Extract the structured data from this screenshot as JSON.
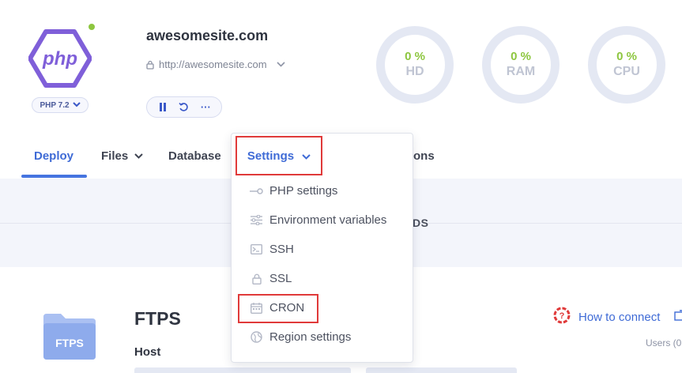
{
  "app": {
    "logo_text": "php",
    "version": "PHP 7.2",
    "site_name": "awesomesite.com",
    "site_url": "http://awesomesite.com",
    "status_color": "#8dc63f"
  },
  "controls": {
    "pause_icon": "pause-icon",
    "restart_icon": "restart-icon",
    "more_label": "···"
  },
  "gauges": [
    {
      "value": "0 %",
      "label": "HD"
    },
    {
      "value": "0 %",
      "label": "RAM"
    },
    {
      "value": "0 %",
      "label": "CPU"
    }
  ],
  "nav": {
    "deploy": "Deploy",
    "files": "Files",
    "database": "Database",
    "settings": "Settings",
    "partial_right": "ons"
  },
  "settings_menu": {
    "items": [
      {
        "label": "PHP settings",
        "icon": "toggle-key-icon"
      },
      {
        "label": "Environment variables",
        "icon": "sliders-icon"
      },
      {
        "label": "SSH",
        "icon": "terminal-icon"
      },
      {
        "label": "SSL",
        "icon": "lock-icon"
      },
      {
        "label": "CRON",
        "icon": "calendar-icon"
      },
      {
        "label": "Region settings",
        "icon": "globe-icon"
      }
    ]
  },
  "content": {
    "section_partial": "DS",
    "ftps_badge": "FTPS",
    "ftps_title": "FTPS",
    "host_label": "Host",
    "how_to_connect": "How to connect",
    "users_partial": "Users (0"
  },
  "colors": {
    "accent": "#3f6bd6",
    "gauge_value": "#8dc63f",
    "highlight": "#e03a3a",
    "logo": "#7f5fd9"
  }
}
